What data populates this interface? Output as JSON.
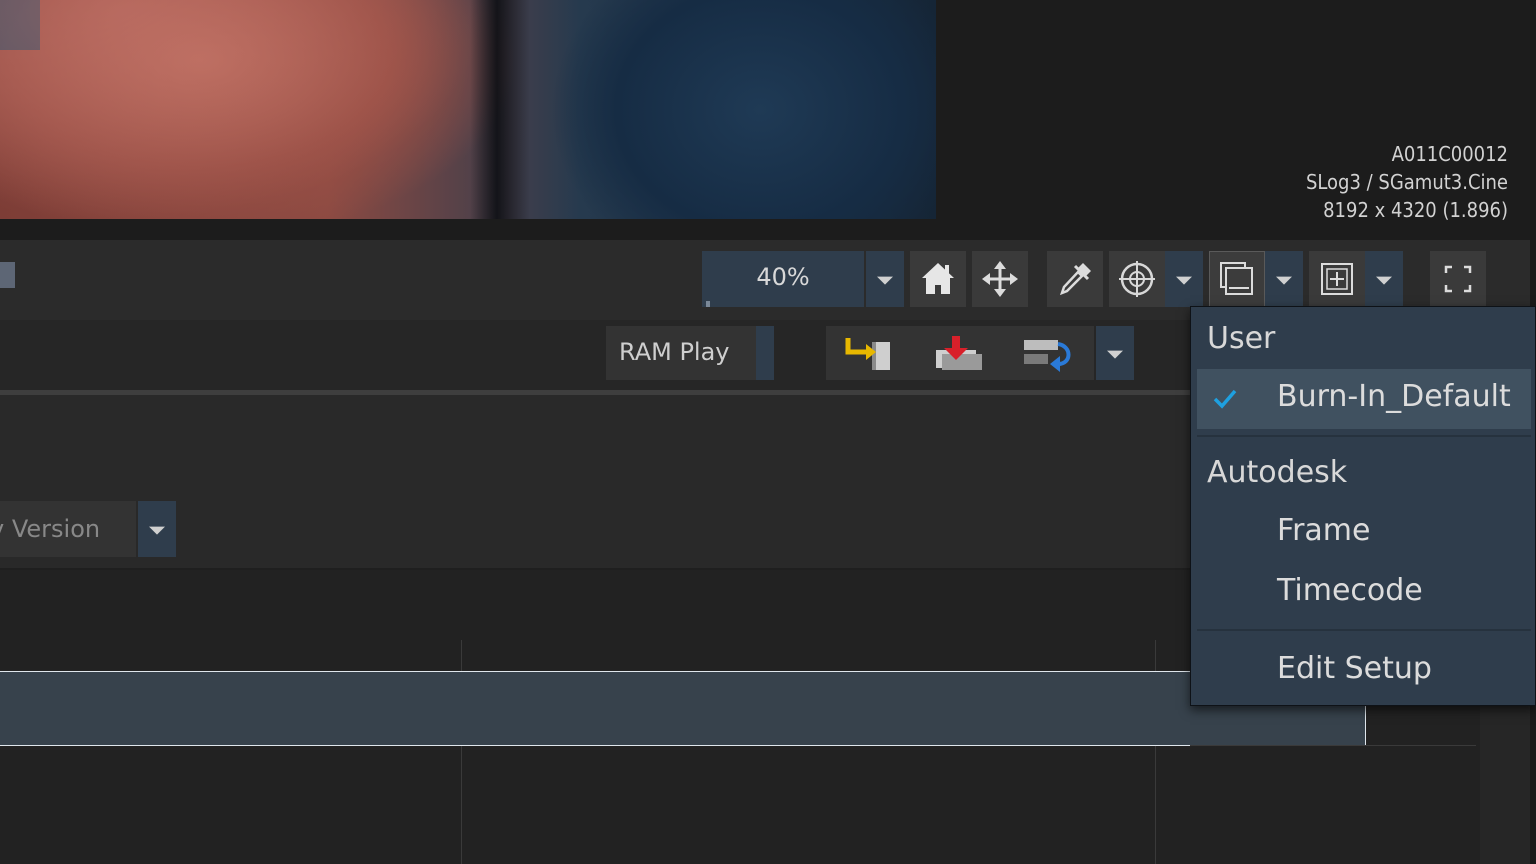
{
  "viewer": {
    "clip_info": {
      "clip_name": "A011C00012",
      "color_space": "SLog3 / SGamut3.Cine",
      "resolution": "8192 x 4320 (1.896)"
    }
  },
  "toolbar": {
    "zoom": {
      "value": "40%",
      "progress": 0.02
    },
    "icons": [
      "home-icon",
      "move-icon",
      "eyedropper-icon",
      "crosshair-icon",
      "overlay-icon",
      "add-frame-icon",
      "fullscreen-icon"
    ]
  },
  "playback": {
    "ram_play_label": "RAM Play",
    "actions": [
      "insert-icon",
      "overwrite-icon",
      "replace-icon"
    ]
  },
  "version": {
    "label": "v Version"
  },
  "burnin_menu": {
    "section_user": "User",
    "item_burnin_default": "Burn-In_Default",
    "section_autodesk": "Autodesk",
    "item_frame": "Frame",
    "item_timecode": "Timecode",
    "item_edit_setup": "Edit Setup",
    "selected": "Burn-In_Default",
    "accent_color": "#1ea0e0"
  },
  "colors": {
    "background": "#262626",
    "button": "#3a3a3a",
    "accent_field": "#2f3d4c",
    "menu_bg": "#2f3d4c",
    "menu_selected": "#405160",
    "insert_arrow": "#e8b800",
    "overwrite_arrow": "#d8202a",
    "replace_arrow": "#2a7ad8"
  }
}
